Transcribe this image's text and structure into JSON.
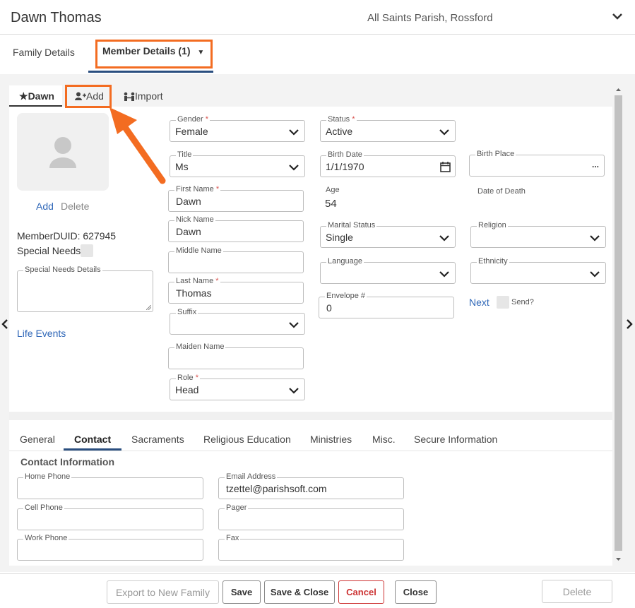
{
  "header": {
    "name": "Dawn Thomas",
    "parish": "All Saints Parish, Rossford"
  },
  "top_tabs": {
    "family": "Family Details",
    "member": "Member Details (1)",
    "caret": "▼"
  },
  "member_tabs": {
    "dawn": "Dawn",
    "add": "Add",
    "import": "Import"
  },
  "photo": {
    "add": "Add",
    "delete": "Delete"
  },
  "member": {
    "duid": "MemberDUID: 627945",
    "special_needs": "Special Needs",
    "special_needs_details_label": "Special Needs Details",
    "life_events": "Life Events"
  },
  "fields": {
    "gender": {
      "label": "Gender",
      "value": "Female"
    },
    "title": {
      "label": "Title",
      "value": "Ms"
    },
    "first_name": {
      "label": "First Name",
      "value": "Dawn"
    },
    "nick_name": {
      "label": "Nick Name",
      "value": "Dawn"
    },
    "middle_name": {
      "label": "Middle Name",
      "value": ""
    },
    "last_name": {
      "label": "Last Name",
      "value": "Thomas"
    },
    "suffix": {
      "label": "Suffix",
      "value": ""
    },
    "maiden_name": {
      "label": "Maiden Name",
      "value": ""
    },
    "role": {
      "label": "Role",
      "value": "Head"
    },
    "status": {
      "label": "Status",
      "value": "Active"
    },
    "birth_date": {
      "label": "Birth Date",
      "value": "1/1/1970"
    },
    "age": {
      "label": "Age",
      "value": "54"
    },
    "marital_status": {
      "label": "Marital Status",
      "value": "Single"
    },
    "language": {
      "label": "Language",
      "value": ""
    },
    "envelope": {
      "label": "Envelope #",
      "value": "0"
    },
    "birth_place": {
      "label": "Birth Place",
      "value": "",
      "more": "..."
    },
    "date_of_death": {
      "label": "Date of Death"
    },
    "religion": {
      "label": "Religion",
      "value": ""
    },
    "ethnicity": {
      "label": "Ethnicity",
      "value": ""
    },
    "next": "Next",
    "send": "Send?"
  },
  "required_mark": "*",
  "bottom_tabs": [
    "General",
    "Contact",
    "Sacraments",
    "Religious Education",
    "Ministries",
    "Misc.",
    "Secure Information"
  ],
  "contact": {
    "heading": "Contact Information",
    "home_phone": {
      "label": "Home Phone",
      "value": ""
    },
    "email": {
      "label": "Email Address",
      "value": "tzettel@parishsoft.com"
    },
    "cell_phone": {
      "label": "Cell Phone",
      "value": ""
    },
    "pager": {
      "label": "Pager",
      "value": ""
    },
    "work_phone": {
      "label": "Work Phone",
      "value": ""
    },
    "fax": {
      "label": "Fax",
      "value": ""
    }
  },
  "footer": {
    "export": "Export to New Family",
    "save": "Save",
    "save_close": "Save & Close",
    "cancel": "Cancel",
    "close": "Close",
    "delete": "Delete"
  },
  "colors": {
    "accent": "#2a4e7f",
    "highlight": "#f36c21",
    "link": "#2f67b8",
    "danger": "#cc3333"
  }
}
